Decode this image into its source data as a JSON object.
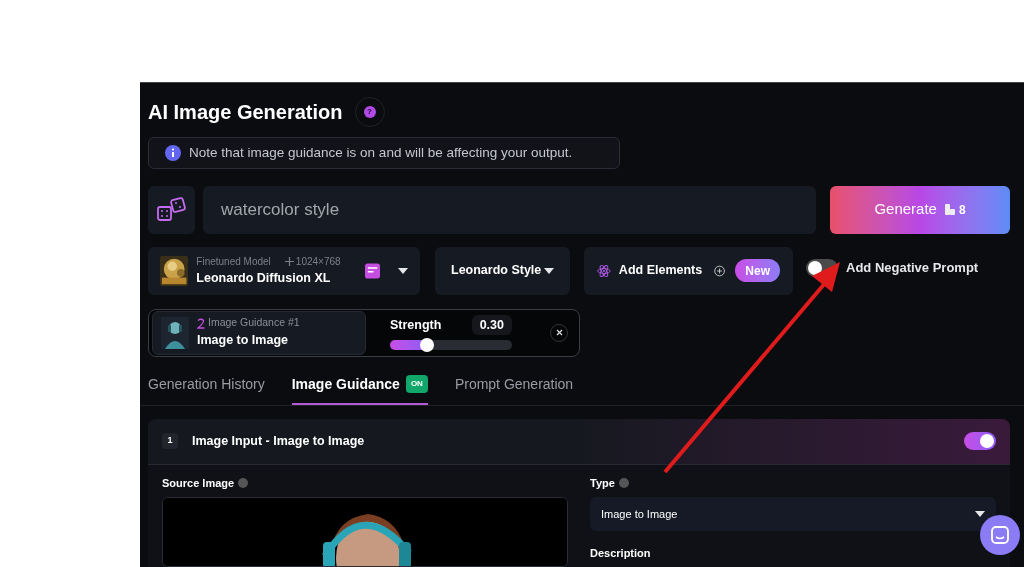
{
  "header": {
    "title": "AI Image Generation",
    "help_icon": "?"
  },
  "notice": {
    "text": "Note that image guidance is on and will be affecting your output."
  },
  "prompt": {
    "value": "watercolor style"
  },
  "generate_button": {
    "label": "Generate",
    "cost": "8"
  },
  "model": {
    "caption": "Finetuned Model",
    "size": "1024×768",
    "name": "Leonardo Diffusion XL"
  },
  "style": {
    "value": "Leonardo Style"
  },
  "elements": {
    "label": "Add Elements",
    "badge": "New"
  },
  "negative_prompt": {
    "label": "Add Negative Prompt",
    "on": false
  },
  "guidance_card": {
    "caption": "Image Guidance #1",
    "type": "Image to Image",
    "strength_label": "Strength",
    "strength_value": "0.30",
    "level": 0.3
  },
  "tabs": [
    {
      "label": "Generation History",
      "selected": false
    },
    {
      "label": "Image Guidance",
      "badge": "ON",
      "selected": true
    },
    {
      "label": "Prompt Generation",
      "selected": false
    }
  ],
  "section": {
    "number": "1",
    "title": "Image Input - Image to Image",
    "on": true,
    "source_label": "Source Image",
    "type_label": "Type",
    "type_value": "Image to Image",
    "description_label": "Description"
  }
}
